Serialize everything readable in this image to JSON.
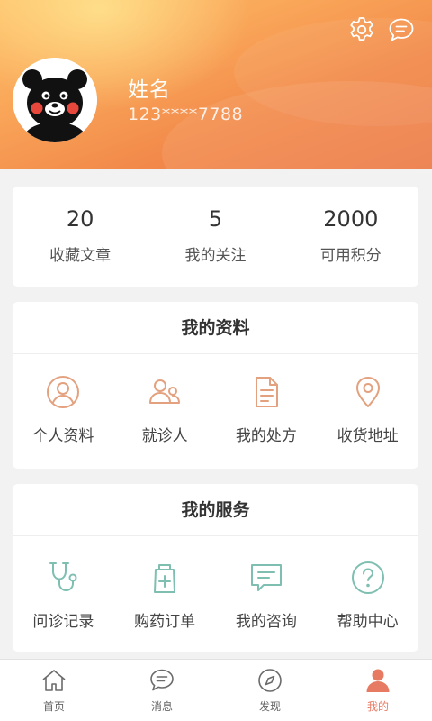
{
  "colors": {
    "accent": "#e67a63",
    "profile_icon": "#e3a17f",
    "service_icon": "#7fbfb2",
    "header_start": "#ffc06a",
    "header_end": "#ec7b48"
  },
  "header": {
    "user_name": "姓名",
    "phone": "123****7788",
    "icons": [
      "settings-icon",
      "message-icon"
    ]
  },
  "stats": [
    {
      "value": "20",
      "label": "收藏文章"
    },
    {
      "value": "5",
      "label": "我的关注"
    },
    {
      "value": "2000",
      "label": "可用积分"
    }
  ],
  "profile_section": {
    "title": "我的资料",
    "items": [
      {
        "label": "个人资料",
        "icon": "user-circle-icon"
      },
      {
        "label": "就诊人",
        "icon": "patients-icon"
      },
      {
        "label": "我的处方",
        "icon": "document-icon"
      },
      {
        "label": "收货地址",
        "icon": "location-pin-icon"
      }
    ]
  },
  "services_section": {
    "title": "我的服务",
    "items": [
      {
        "label": "问诊记录",
        "icon": "stethoscope-icon"
      },
      {
        "label": "购药订单",
        "icon": "medicine-bag-icon"
      },
      {
        "label": "我的咨询",
        "icon": "chat-box-icon"
      },
      {
        "label": "帮助中心",
        "icon": "help-circle-icon"
      }
    ]
  },
  "bottom_nav": {
    "active_index": 3,
    "items": [
      {
        "label": "首页",
        "icon": "home-icon"
      },
      {
        "label": "消息",
        "icon": "message-bubble-icon"
      },
      {
        "label": "发现",
        "icon": "compass-icon"
      },
      {
        "label": "我的",
        "icon": "person-icon"
      }
    ]
  }
}
